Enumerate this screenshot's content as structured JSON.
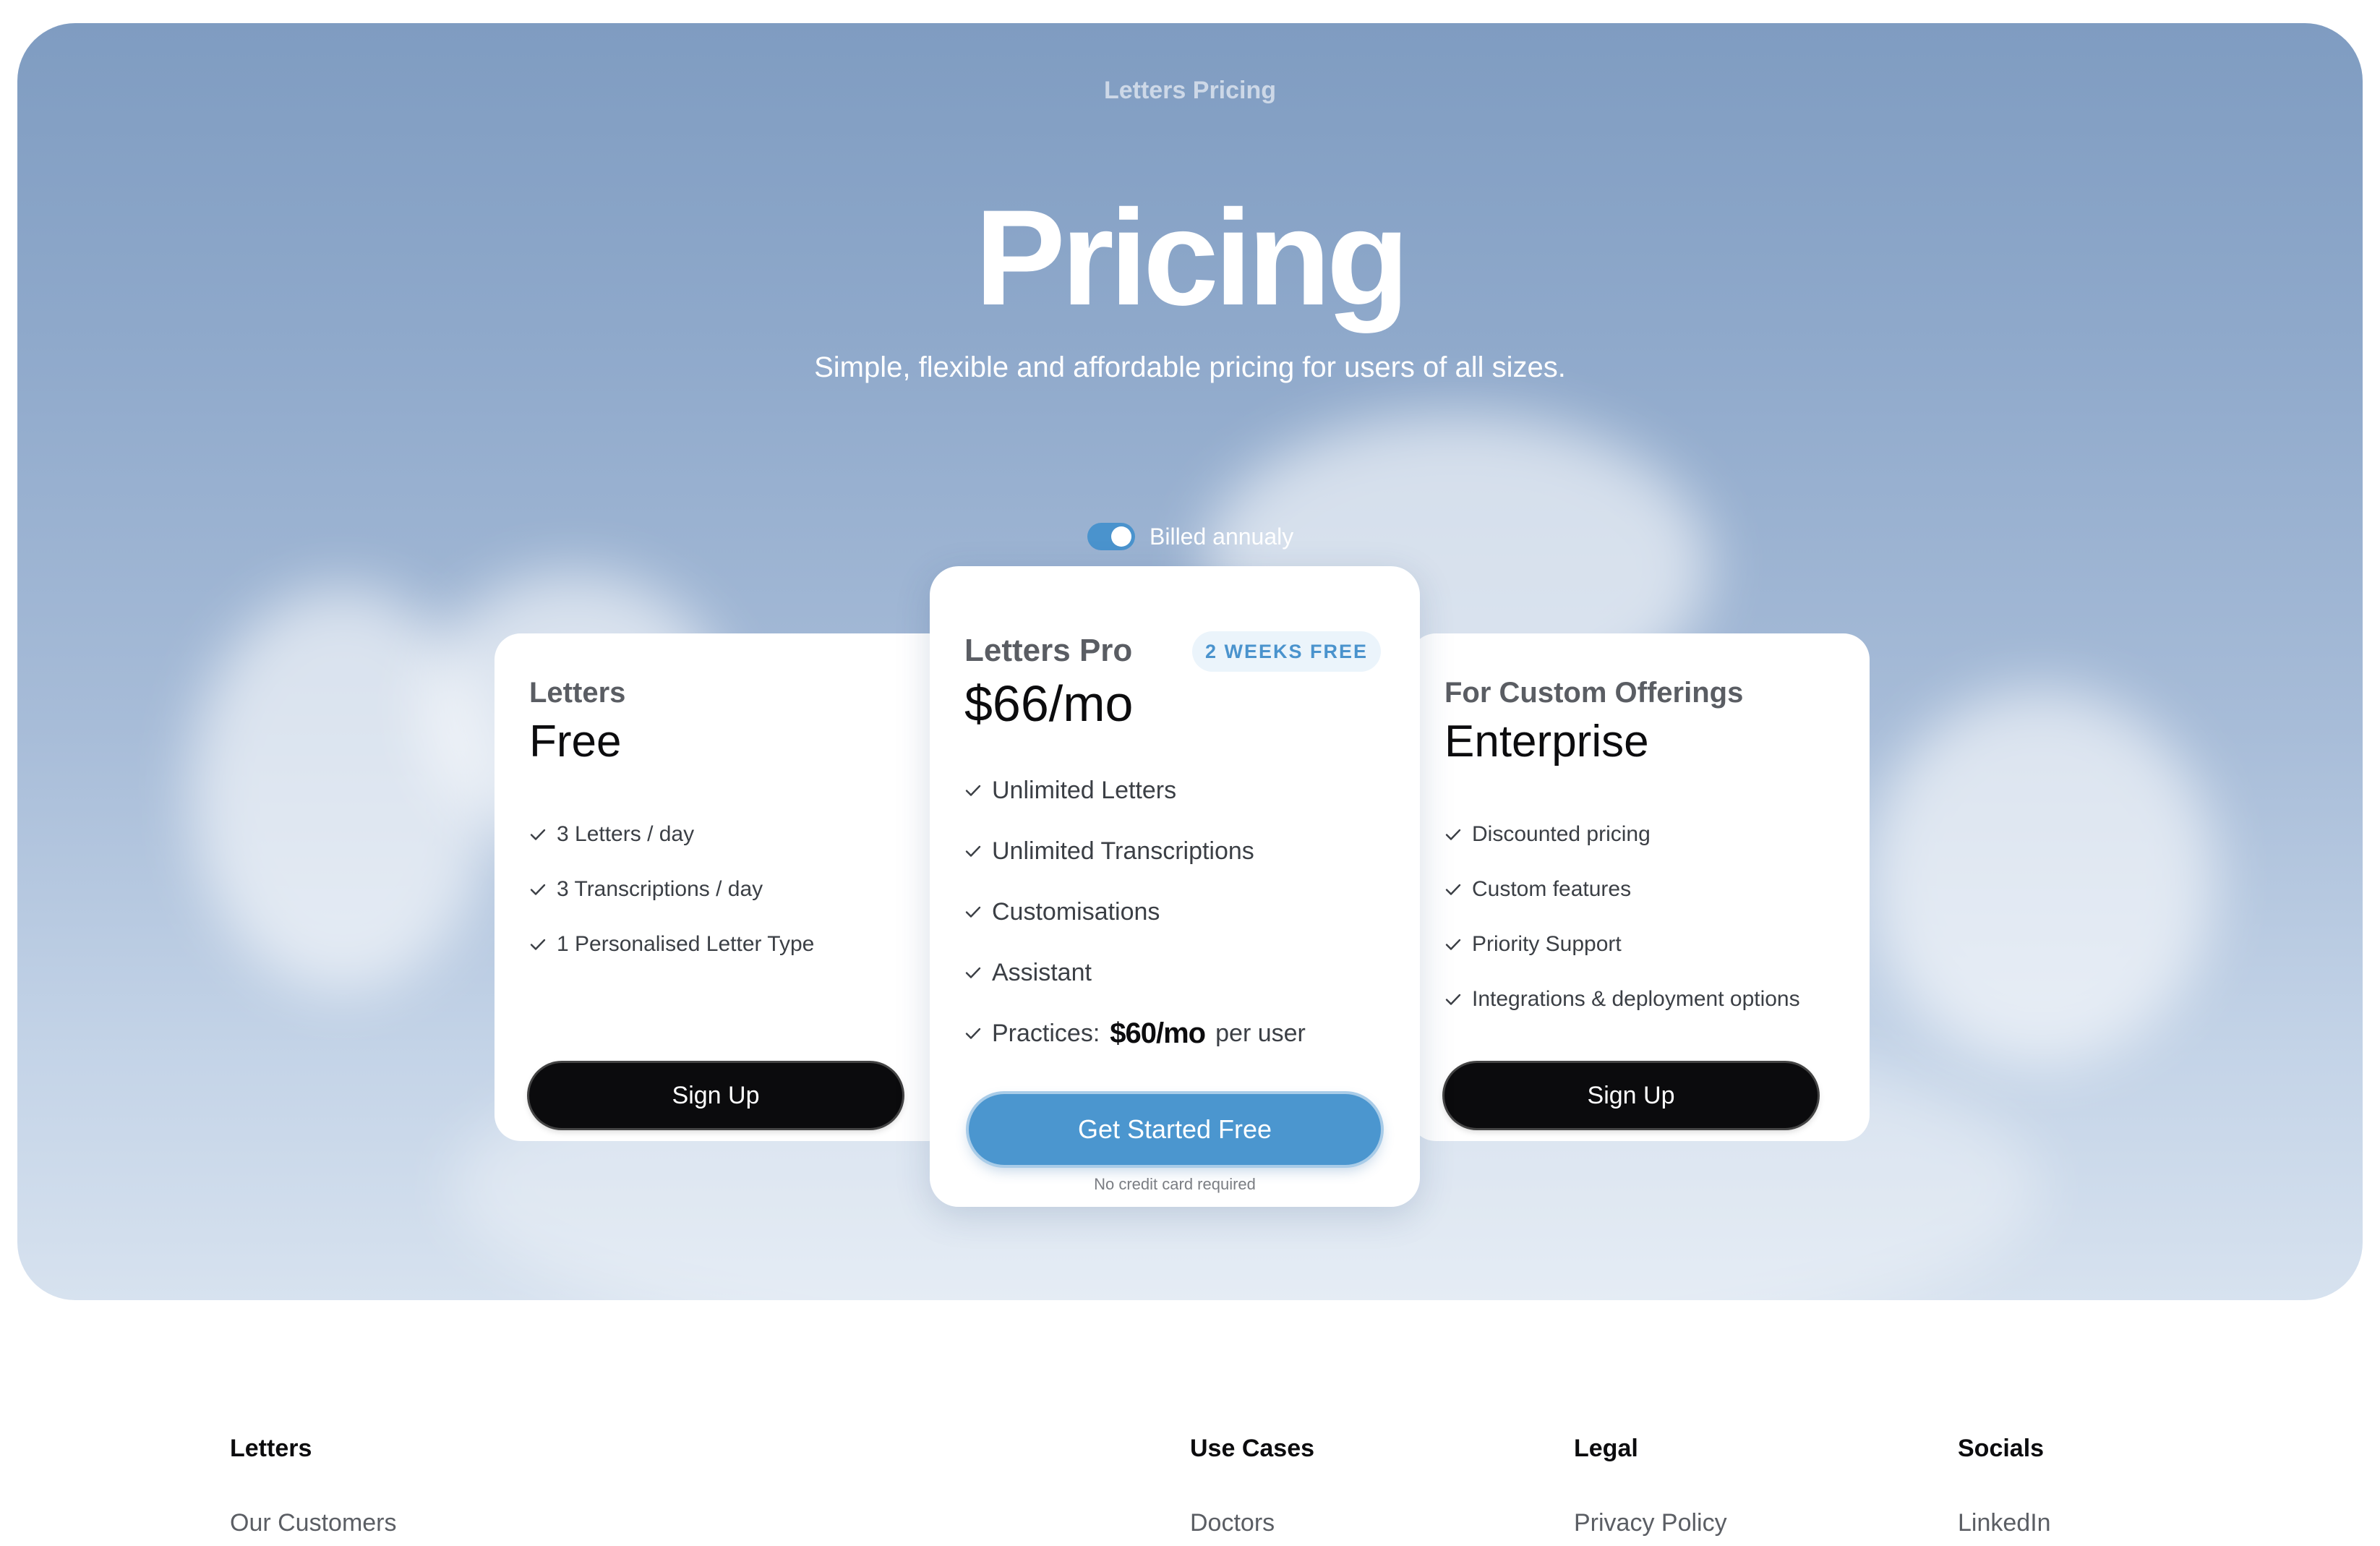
{
  "hero": {
    "eyebrow": "Letters Pricing",
    "title": "Pricing",
    "subtitle": "Simple, flexible and affordable pricing for users of all sizes.",
    "billing": {
      "label": "Billed annualy",
      "enabled": true,
      "accent": "#4a93cd"
    }
  },
  "plans": {
    "free": {
      "label": "Letters",
      "price": "Free",
      "features": [
        "3 Letters / day",
        "3 Transcriptions / day",
        "1 Personalised Letter Type"
      ],
      "cta": "Sign Up"
    },
    "pro": {
      "label": "Letters Pro",
      "badge": "2 WEEKS FREE",
      "price": "$66/mo",
      "features": [
        "Unlimited Letters",
        "Unlimited Transcriptions",
        "Customisations",
        "Assistant"
      ],
      "practices": {
        "prefix": "Practices:",
        "amount": "$60/mo",
        "suffix": "per user"
      },
      "cta": "Get Started Free",
      "note": "No credit card required"
    },
    "enterprise": {
      "label": "For Custom Offerings",
      "price": "Enterprise",
      "features": [
        "Discounted pricing",
        "Custom features",
        "Priority Support",
        "Integrations & deployment options"
      ],
      "cta": "Sign Up"
    }
  },
  "footer": {
    "columns": [
      {
        "heading": "Letters",
        "link": "Our Customers"
      },
      {
        "heading": "Use Cases",
        "link": "Doctors"
      },
      {
        "heading": "Legal",
        "link": "Privacy Policy"
      },
      {
        "heading": "Socials",
        "link": "LinkedIn"
      }
    ]
  },
  "colors": {
    "accent": "#4b96cf",
    "dark_button": "#0b0b0d"
  }
}
